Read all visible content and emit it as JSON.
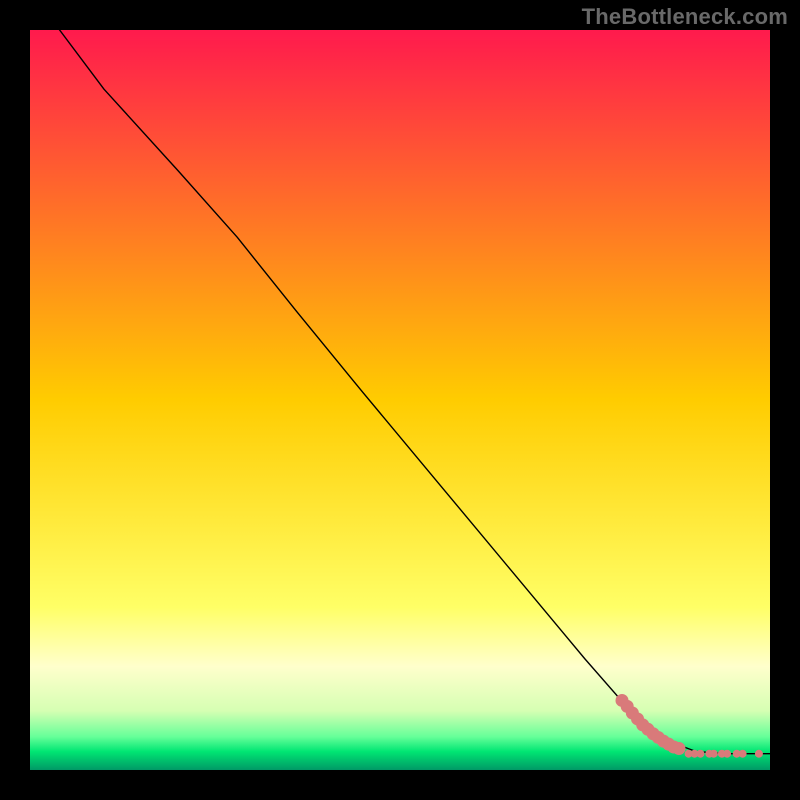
{
  "watermark": "TheBottleneck.com",
  "chart_data": {
    "type": "line",
    "title": "",
    "xlabel": "",
    "ylabel": "",
    "xlim": [
      0,
      100
    ],
    "ylim": [
      0,
      100
    ],
    "background_gradient": {
      "stops": [
        {
          "offset": 0.0,
          "color": "#ff1a4d"
        },
        {
          "offset": 0.5,
          "color": "#ffcc00"
        },
        {
          "offset": 0.78,
          "color": "#ffff66"
        },
        {
          "offset": 0.86,
          "color": "#ffffcc"
        },
        {
          "offset": 0.92,
          "color": "#d6ffb3"
        },
        {
          "offset": 0.955,
          "color": "#66ff99"
        },
        {
          "offset": 0.975,
          "color": "#00e673"
        },
        {
          "offset": 1.0,
          "color": "#009966"
        }
      ]
    },
    "series": [
      {
        "name": "curve",
        "color": "#000000",
        "stroke_width": 1.4,
        "x": [
          4,
          10,
          20,
          28,
          36,
          45,
          55,
          65,
          75,
          82,
          86,
          90,
          94,
          100
        ],
        "y": [
          100,
          92,
          81,
          72,
          62,
          51,
          39,
          27,
          15,
          7,
          4,
          2.5,
          2.2,
          2.2
        ]
      }
    ],
    "markers": {
      "name": "tail-markers",
      "color": "#d97a7a",
      "radius": 5,
      "on_line": [
        {
          "x": 80,
          "y": 9.4
        },
        {
          "x": 80.7,
          "y": 8.6
        },
        {
          "x": 81.4,
          "y": 7.7
        },
        {
          "x": 82.1,
          "y": 6.9
        },
        {
          "x": 82.8,
          "y": 6.1
        },
        {
          "x": 83.5,
          "y": 5.5
        },
        {
          "x": 84.2,
          "y": 4.9
        },
        {
          "x": 84.9,
          "y": 4.4
        },
        {
          "x": 85.6,
          "y": 3.9
        },
        {
          "x": 86.3,
          "y": 3.5
        },
        {
          "x": 87.0,
          "y": 3.1
        },
        {
          "x": 87.7,
          "y": 2.9
        }
      ],
      "flat": [
        {
          "x": 89.0,
          "y": 2.2
        },
        {
          "x": 89.8,
          "y": 2.2
        },
        {
          "x": 90.6,
          "y": 2.2
        },
        {
          "x": 91.8,
          "y": 2.2
        },
        {
          "x": 92.4,
          "y": 2.2
        },
        {
          "x": 93.5,
          "y": 2.2
        },
        {
          "x": 94.2,
          "y": 2.2
        },
        {
          "x": 95.5,
          "y": 2.2
        },
        {
          "x": 96.3,
          "y": 2.2
        },
        {
          "x": 98.5,
          "y": 2.2
        }
      ]
    }
  }
}
